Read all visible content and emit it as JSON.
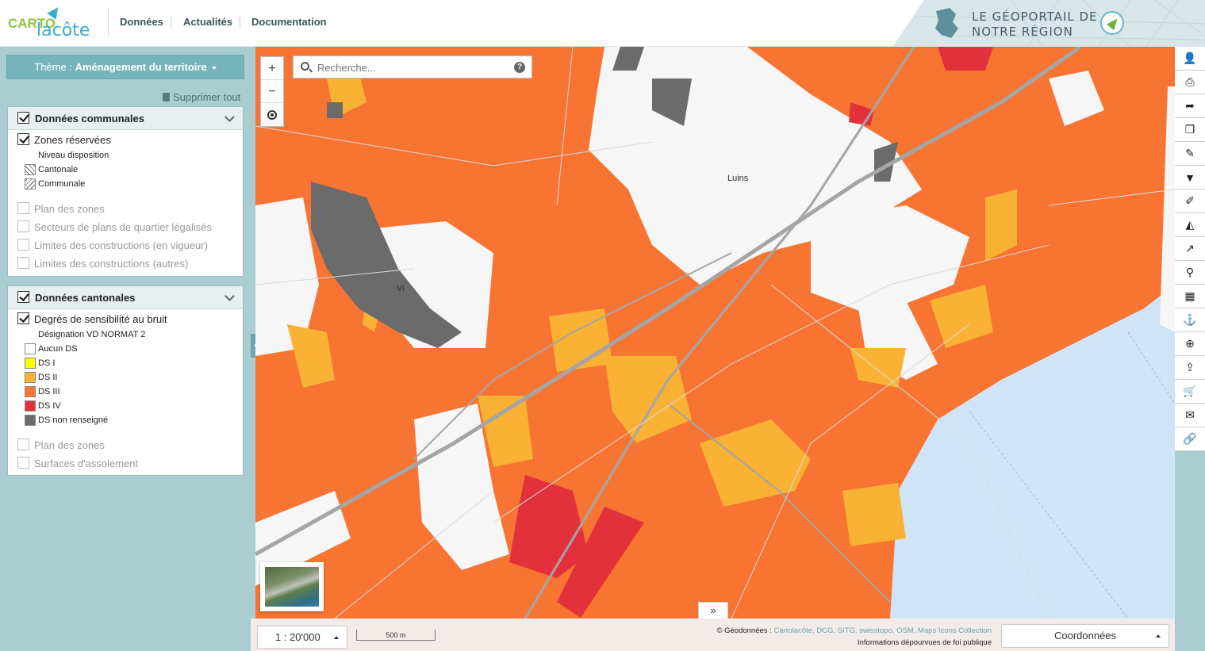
{
  "header": {
    "logo_line1": "CARTO",
    "logo_line2": "lacôte",
    "nav": [
      "Données",
      "Actualités",
      "Documentation"
    ],
    "banner_line1": "LE GÉOPORTAIL DE",
    "banner_line2": "NOTRE RÉGION"
  },
  "sidebar": {
    "theme_prefix": "Thème : ",
    "theme_value": "Aménagement du territoire",
    "remove_all": "Supprimer tout",
    "communal": {
      "title": "Données communales",
      "active_layer": "Zones réservées",
      "legend_title": "Niveau disposition",
      "legend": [
        "Cantonale",
        "Communale"
      ],
      "inactive_layers": [
        "Plan des zones",
        "Secteurs de plans de quartier légalisés",
        "Limites des constructions (en vigueur)",
        "Limites des constructions (autres)"
      ]
    },
    "cantonal": {
      "title": "Données cantonales",
      "active_layer": "Degrés de sensibilité au bruit",
      "legend_title": "Désignation VD NORMAT 2",
      "legend": [
        {
          "label": "Aucun DS",
          "color": "#ffffff"
        },
        {
          "label": "DS I",
          "color": "#ffff00"
        },
        {
          "label": "DS II",
          "color": "#f9b233"
        },
        {
          "label": "DS III",
          "color": "#f77432"
        },
        {
          "label": "DS IV",
          "color": "#e3313b"
        },
        {
          "label": "DS non renseigné",
          "color": "#6b6b6b"
        }
      ],
      "inactive_layers": [
        "Plan des zones",
        "Surfaces d'assolement"
      ]
    }
  },
  "map": {
    "search_placeholder": "Recherche...",
    "place_label": "Luins",
    "place_label_2": "Vi",
    "zoom_in": "+",
    "zoom_out": "−",
    "colors": {
      "ds3": "#f77432",
      "ds2": "#f9b233",
      "ds4": "#e3313b",
      "none": "#f6f6f6",
      "unknown": "#6b6b6b",
      "lake": "#cfe5f7"
    }
  },
  "footer": {
    "scale": "1 : 20'000",
    "scalebar": "500 m",
    "credits_prefix": "© Géodonnées : ",
    "credits_links": "Cartolacôte, DCG, SITG, swisstopo, OSM, Maps Icons Collection",
    "disclaimer": "Informations dépourvues de foi publique",
    "coordinates": "Coordonnées"
  },
  "toolbar": {
    "tools": [
      "user-admin-icon",
      "print-icon",
      "share-icon",
      "layers-icon",
      "draw-icon",
      "filter-icon",
      "edit-icon",
      "profile-icon",
      "chart-icon",
      "query-icon",
      "calculator-icon",
      "measure-icon",
      "zoom-icon",
      "upload-icon",
      "cart-icon",
      "mail-icon",
      "link-icon"
    ]
  }
}
